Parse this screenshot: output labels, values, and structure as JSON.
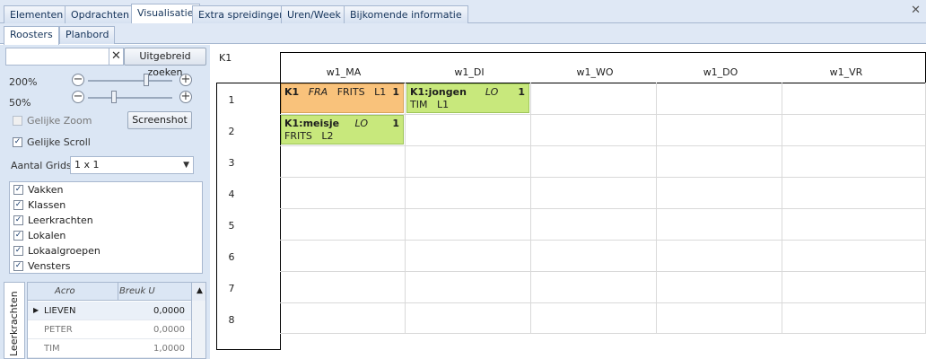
{
  "tabs": [
    "Elementen",
    "Opdrachten",
    "Visualisatie",
    "Extra spreidingen",
    "Uren/Week",
    "Bijkomende informatie"
  ],
  "active_tab": "Visualisatie",
  "subtabs": [
    "Roosters",
    "Planbord"
  ],
  "left": {
    "search_placeholder": "",
    "advanced_search": "Uitgebreid zoeken",
    "zoom1": "200%",
    "zoom2": "50%",
    "equal_zoom": "Gelijke Zoom",
    "screenshot": "Screenshot",
    "equal_scroll": "Gelijke Scroll",
    "grids_label": "Aantal Grids",
    "grids_value": "1 x 1",
    "checklist": [
      "Vakken",
      "Klassen",
      "Leerkrachten",
      "Lokalen",
      "Lokaalgroepen",
      "Vensters"
    ],
    "side_tab": "Leerkrachten",
    "grid_cols": [
      "Acro",
      "Breuk U"
    ],
    "grid_rows": [
      {
        "acro": "LIEVEN",
        "breuk": "0,0000"
      },
      {
        "acro": "PETER",
        "breuk": "0,0000"
      },
      {
        "acro": "TIM",
        "breuk": "1,0000"
      }
    ]
  },
  "roster": {
    "title": "K1",
    "days": [
      "w1_MA",
      "w1_DI",
      "w1_WO",
      "w1_DO",
      "w1_VR"
    ],
    "periods": [
      "1",
      "2",
      "3",
      "4",
      "5",
      "6",
      "7",
      "8"
    ],
    "lessons": [
      {
        "class": "K1",
        "subject": "FRA",
        "teacher": "FRITS",
        "room": "L1",
        "count": "1",
        "color": "#f9c27b"
      },
      {
        "class": "K1:jongen",
        "subject": "LO",
        "teacher": "TIM",
        "room": "L1",
        "count": "1",
        "color": "#c8e87c"
      },
      {
        "class": "K1:meisje",
        "subject": "LO",
        "teacher": "FRITS",
        "room": "L2",
        "count": "1",
        "color": "#c8e87c"
      }
    ]
  }
}
